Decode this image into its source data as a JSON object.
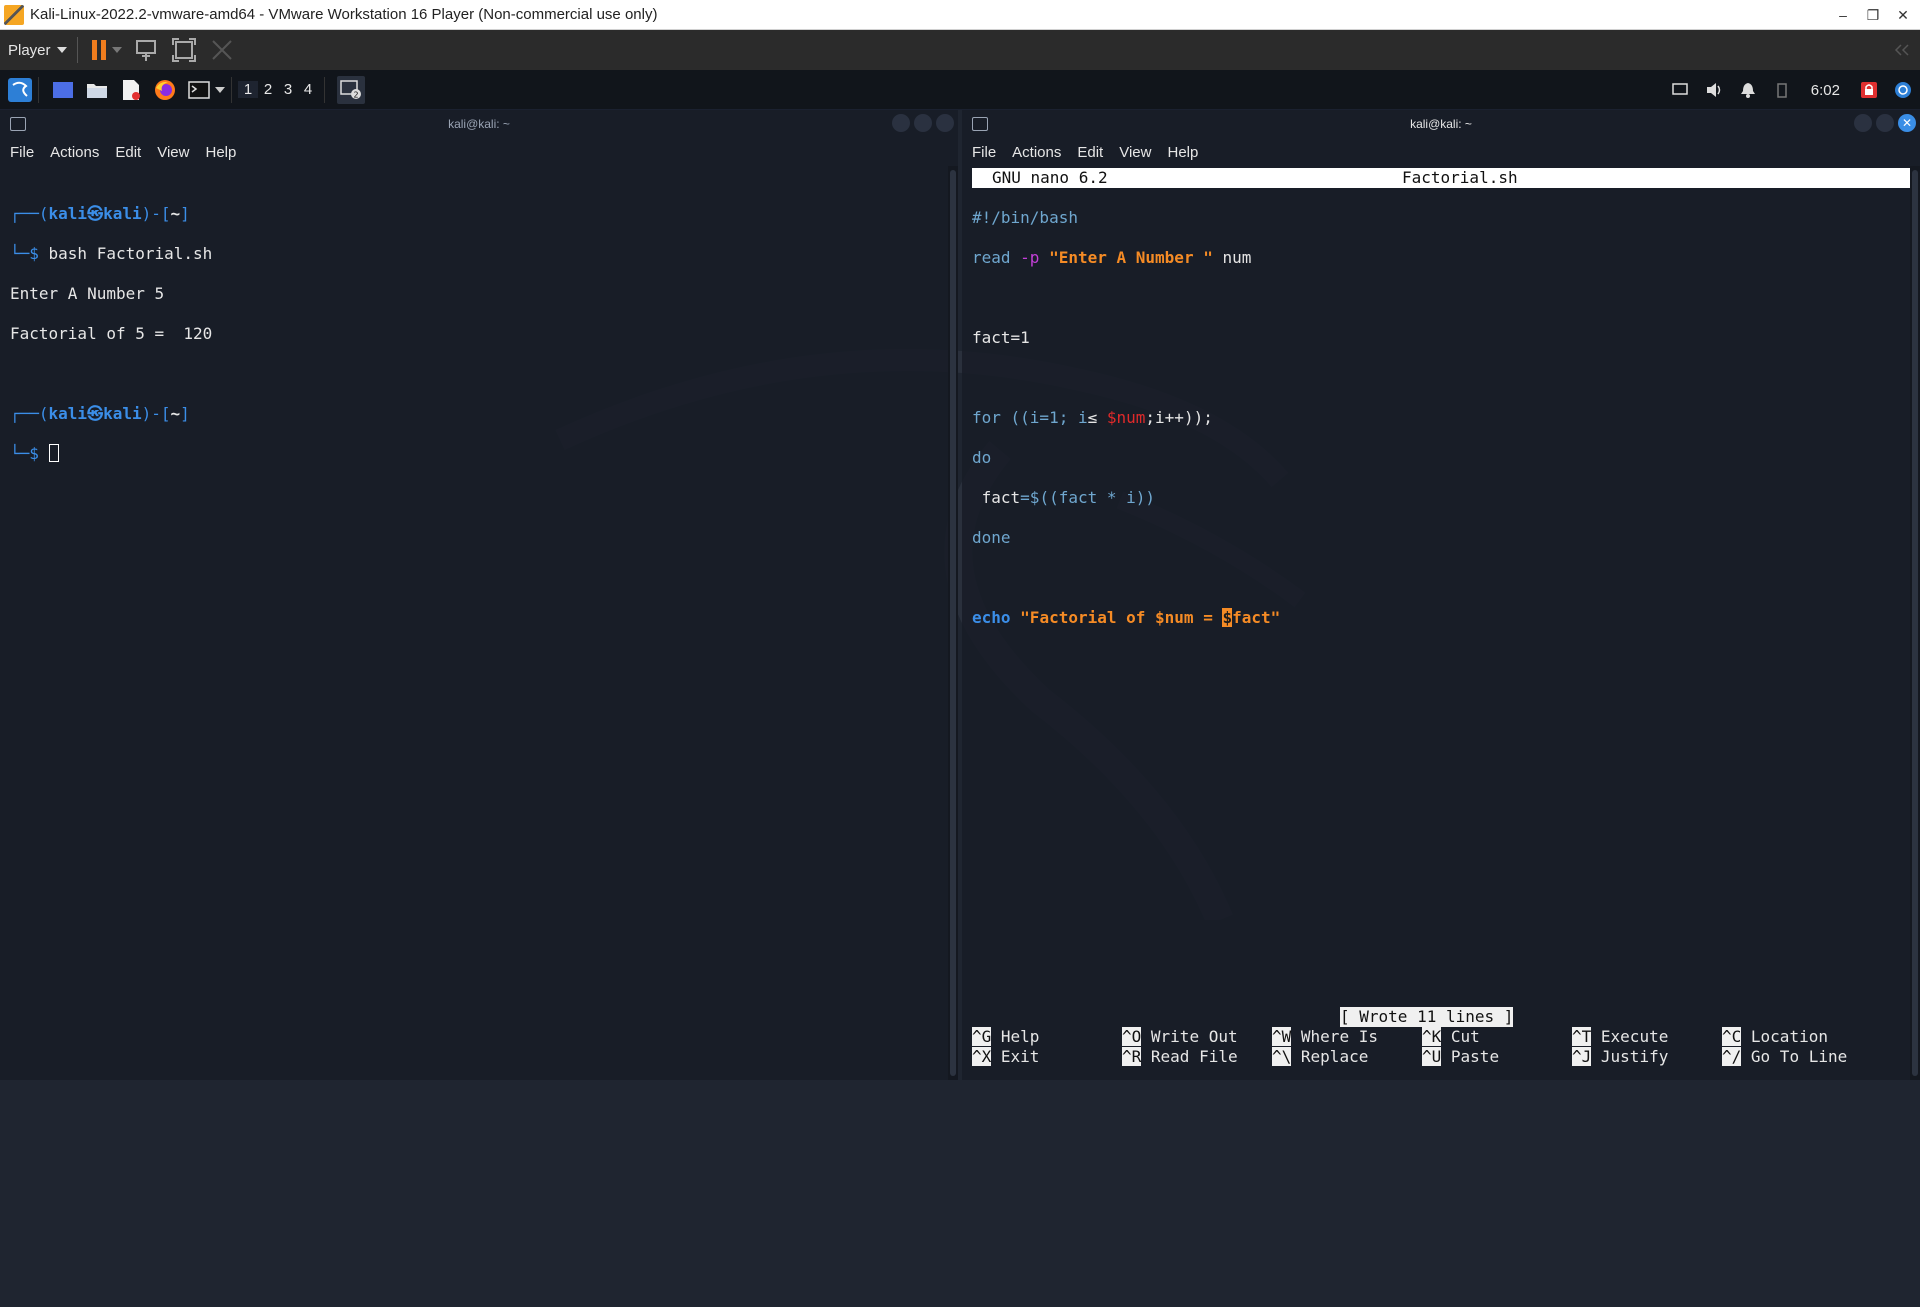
{
  "window": {
    "title": "Kali-Linux-2022.2-vmware-amd64 - VMware Workstation 16 Player (Non-commercial use only)",
    "minimize": "–",
    "restore": "❐",
    "close": "✕"
  },
  "vm_toolbar": {
    "player_label": "Player",
    "icons": [
      "pause-icon",
      "send-ctrl-alt-del-icon",
      "fullscreen-icon",
      "unity-icon"
    ]
  },
  "panel": {
    "workspaces": [
      "1",
      "2",
      "3",
      "4"
    ],
    "clock": "6:02",
    "colors": {
      "panel_bg": "#11151b",
      "accent": "#3b8ee8"
    }
  },
  "left_terminal": {
    "title": "kali@kali: ~",
    "menu": [
      "File",
      "Actions",
      "Edit",
      "View",
      "Help"
    ],
    "lines": {
      "prompt1_open": "┌──(",
      "prompt1_user": "kali㉿kali",
      "prompt1_close": ")-[",
      "prompt1_dir": "~",
      "prompt1_end": "]",
      "cmd_prefix": "└─$ ",
      "cmd": "bash Factorial.sh",
      "out1": "Enter A Number 5",
      "out2": "Factorial of 5 =  120",
      "prompt2_open": "┌──(",
      "prompt2_user": "kali㉿kali",
      "prompt2_close": ")-[",
      "prompt2_dir": "~",
      "prompt2_end": "]",
      "cmd2_prefix": "└─$ "
    }
  },
  "right_terminal": {
    "title": "kali@kali: ~",
    "menu": [
      "File",
      "Actions",
      "Edit",
      "View",
      "Help"
    ],
    "nano": {
      "version": "GNU nano 6.2",
      "filename": "Factorial.sh",
      "code": {
        "shebang": "#!/bin/bash",
        "read_kw": "read",
        "read_flag": "-p",
        "read_str": "\"Enter A Number \"",
        "read_var": " num",
        "fact_init": "fact=1",
        "for_a": "for ((i=1; i",
        "for_le": "≤",
        "for_var": "$num",
        "for_b": ";i++));",
        "do": "do",
        "body_a": " fact",
        "body_b": "=$((fact * i))",
        "done": "done",
        "echo_kw": "echo",
        "echo_str_a": "\"Factorial of $num = ",
        "echo_cursor": "$",
        "echo_str_b": "fact\""
      },
      "status": "[ Wrote 11 lines ]",
      "shortcuts": [
        {
          "key": "^G",
          "label": "Help"
        },
        {
          "key": "^O",
          "label": "Write Out"
        },
        {
          "key": "^W",
          "label": "Where Is"
        },
        {
          "key": "^K",
          "label": "Cut"
        },
        {
          "key": "^T",
          "label": "Execute"
        },
        {
          "key": "^C",
          "label": "Location"
        },
        {
          "key": "^X",
          "label": "Exit"
        },
        {
          "key": "^R",
          "label": "Read File"
        },
        {
          "key": "^\\",
          "label": "Replace"
        },
        {
          "key": "^U",
          "label": "Paste"
        },
        {
          "key": "^J",
          "label": "Justify"
        },
        {
          "key": "^/",
          "label": "Go To Line"
        }
      ]
    }
  }
}
